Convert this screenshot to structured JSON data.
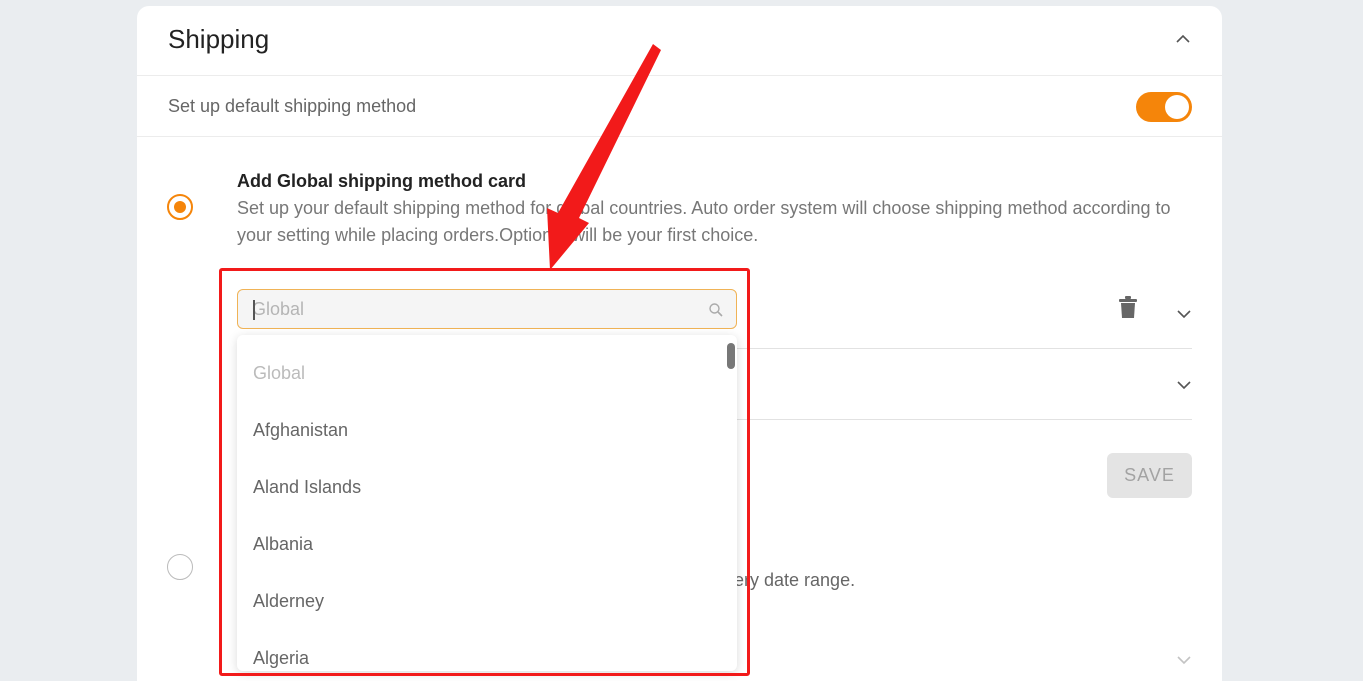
{
  "section": {
    "title": "Shipping",
    "collapse_icon": "chevron-up-icon"
  },
  "default_shipping": {
    "label": "Set up default shipping method",
    "enabled": true,
    "accent_color": "#f5850a"
  },
  "global_option": {
    "title": "Add Global shipping method card",
    "description": "Set up your default shipping method for global countries. Auto order system will choose shipping method according to your setting while placing orders.Option 1 will be your first choice."
  },
  "country_search": {
    "placeholder": "Global",
    "value": ""
  },
  "dropdown": {
    "items": [
      "Global",
      "Afghanistan",
      "Aland Islands",
      "Albania",
      "Alderney",
      "Algeria"
    ]
  },
  "save_button": {
    "label": "SAVE"
  },
  "second_option": {
    "partial_desc": "ery date range."
  },
  "annotation": {
    "highlight_color": "#f21a1a"
  }
}
